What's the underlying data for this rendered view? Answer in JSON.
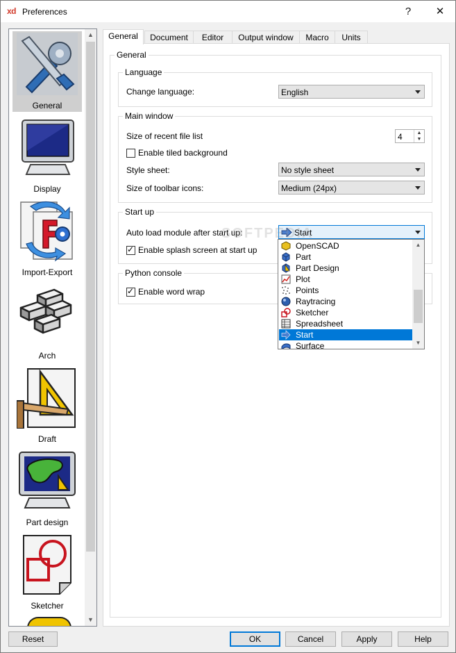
{
  "window": {
    "app_logo": "xd",
    "title": "Preferences",
    "help_glyph": "?",
    "close_glyph": "✕"
  },
  "sidebar": {
    "items": [
      {
        "label": "General",
        "icon": "wrench-screwdriver-icon",
        "selected": true
      },
      {
        "label": "Display",
        "icon": "monitor-icon"
      },
      {
        "label": "Import-Export",
        "icon": "import-export-icon"
      },
      {
        "label": "Arch",
        "icon": "bricks-icon"
      },
      {
        "label": "Draft",
        "icon": "set-square-ruler-icon"
      },
      {
        "label": "Part design",
        "icon": "part-design-monitor-icon"
      },
      {
        "label": "Sketcher",
        "icon": "sketcher-icon"
      }
    ]
  },
  "tabs": [
    {
      "label": "General",
      "selected": true
    },
    {
      "label": "Document"
    },
    {
      "label": "Editor"
    },
    {
      "label": "Output window"
    },
    {
      "label": "Macro"
    },
    {
      "label": "Units"
    }
  ],
  "general": {
    "group_title": "General",
    "language": {
      "title": "Language",
      "change_label": "Change language:",
      "value": "English"
    },
    "main_window": {
      "title": "Main window",
      "recent_files_label": "Size of recent file list",
      "recent_files_value": "4",
      "tiled_bg_label": "Enable tiled background",
      "tiled_bg_checked": false,
      "style_sheet_label": "Style sheet:",
      "style_sheet_value": "No style sheet",
      "toolbar_icons_label": "Size of toolbar icons:",
      "toolbar_icons_value": "Medium (24px)"
    },
    "start_up": {
      "title": "Start up",
      "autoload_label": "Auto load module after start up:",
      "autoload_value": "Start",
      "splash_label": "Enable splash screen at start up",
      "splash_checked": true
    },
    "python_console": {
      "title": "Python console",
      "word_wrap_label": "Enable word wrap",
      "word_wrap_checked": true
    }
  },
  "module_dropdown": {
    "items": [
      {
        "label": "OpenSCAD",
        "icon": "openscad-icon"
      },
      {
        "label": "Part",
        "icon": "part-cube-icon"
      },
      {
        "label": "Part Design",
        "icon": "part-design-icon"
      },
      {
        "label": "Plot",
        "icon": "plot-icon"
      },
      {
        "label": "Points",
        "icon": "points-icon"
      },
      {
        "label": "Raytracing",
        "icon": "raytracing-sphere-icon"
      },
      {
        "label": "Sketcher",
        "icon": "sketcher-small-icon"
      },
      {
        "label": "Spreadsheet",
        "icon": "spreadsheet-icon"
      },
      {
        "label": "Start",
        "icon": "start-arrow-icon",
        "selected": true
      },
      {
        "label": "Surface",
        "icon": "surface-icon"
      }
    ]
  },
  "watermark": "SOFTPEDIA",
  "buttons": {
    "reset": "Reset",
    "ok": "OK",
    "cancel": "Cancel",
    "apply": "Apply",
    "help": "Help"
  },
  "colors": {
    "selection": "#0078d7",
    "dialog_bg": "#f0f0f0",
    "sidebar_selected": "#cfcfcf"
  }
}
